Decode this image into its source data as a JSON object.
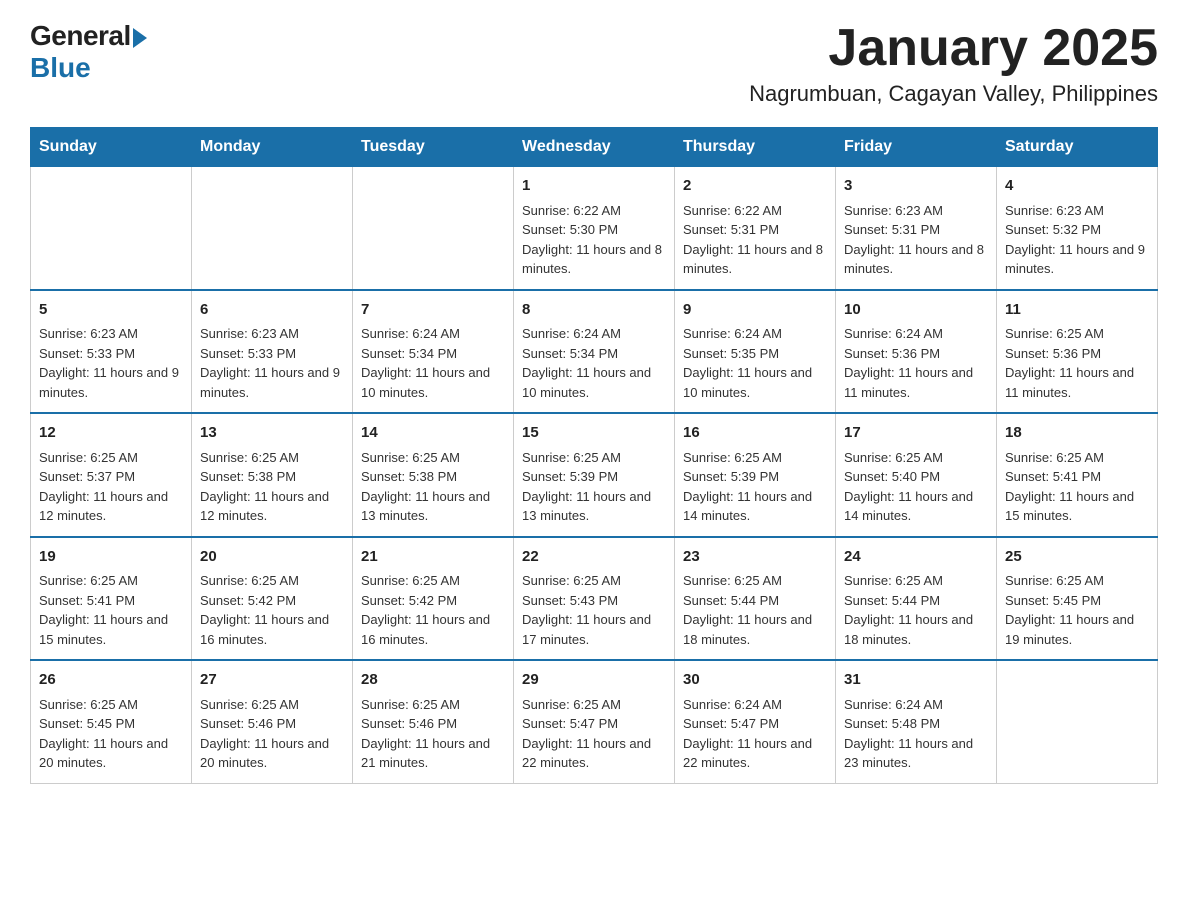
{
  "logo": {
    "general": "General",
    "blue": "Blue"
  },
  "title": {
    "month_year": "January 2025",
    "location": "Nagrumbuan, Cagayan Valley, Philippines"
  },
  "headers": [
    "Sunday",
    "Monday",
    "Tuesday",
    "Wednesday",
    "Thursday",
    "Friday",
    "Saturday"
  ],
  "weeks": [
    [
      {
        "day": "",
        "info": ""
      },
      {
        "day": "",
        "info": ""
      },
      {
        "day": "",
        "info": ""
      },
      {
        "day": "1",
        "info": "Sunrise: 6:22 AM\nSunset: 5:30 PM\nDaylight: 11 hours and 8 minutes."
      },
      {
        "day": "2",
        "info": "Sunrise: 6:22 AM\nSunset: 5:31 PM\nDaylight: 11 hours and 8 minutes."
      },
      {
        "day": "3",
        "info": "Sunrise: 6:23 AM\nSunset: 5:31 PM\nDaylight: 11 hours and 8 minutes."
      },
      {
        "day": "4",
        "info": "Sunrise: 6:23 AM\nSunset: 5:32 PM\nDaylight: 11 hours and 9 minutes."
      }
    ],
    [
      {
        "day": "5",
        "info": "Sunrise: 6:23 AM\nSunset: 5:33 PM\nDaylight: 11 hours and 9 minutes."
      },
      {
        "day": "6",
        "info": "Sunrise: 6:23 AM\nSunset: 5:33 PM\nDaylight: 11 hours and 9 minutes."
      },
      {
        "day": "7",
        "info": "Sunrise: 6:24 AM\nSunset: 5:34 PM\nDaylight: 11 hours and 10 minutes."
      },
      {
        "day": "8",
        "info": "Sunrise: 6:24 AM\nSunset: 5:34 PM\nDaylight: 11 hours and 10 minutes."
      },
      {
        "day": "9",
        "info": "Sunrise: 6:24 AM\nSunset: 5:35 PM\nDaylight: 11 hours and 10 minutes."
      },
      {
        "day": "10",
        "info": "Sunrise: 6:24 AM\nSunset: 5:36 PM\nDaylight: 11 hours and 11 minutes."
      },
      {
        "day": "11",
        "info": "Sunrise: 6:25 AM\nSunset: 5:36 PM\nDaylight: 11 hours and 11 minutes."
      }
    ],
    [
      {
        "day": "12",
        "info": "Sunrise: 6:25 AM\nSunset: 5:37 PM\nDaylight: 11 hours and 12 minutes."
      },
      {
        "day": "13",
        "info": "Sunrise: 6:25 AM\nSunset: 5:38 PM\nDaylight: 11 hours and 12 minutes."
      },
      {
        "day": "14",
        "info": "Sunrise: 6:25 AM\nSunset: 5:38 PM\nDaylight: 11 hours and 13 minutes."
      },
      {
        "day": "15",
        "info": "Sunrise: 6:25 AM\nSunset: 5:39 PM\nDaylight: 11 hours and 13 minutes."
      },
      {
        "day": "16",
        "info": "Sunrise: 6:25 AM\nSunset: 5:39 PM\nDaylight: 11 hours and 14 minutes."
      },
      {
        "day": "17",
        "info": "Sunrise: 6:25 AM\nSunset: 5:40 PM\nDaylight: 11 hours and 14 minutes."
      },
      {
        "day": "18",
        "info": "Sunrise: 6:25 AM\nSunset: 5:41 PM\nDaylight: 11 hours and 15 minutes."
      }
    ],
    [
      {
        "day": "19",
        "info": "Sunrise: 6:25 AM\nSunset: 5:41 PM\nDaylight: 11 hours and 15 minutes."
      },
      {
        "day": "20",
        "info": "Sunrise: 6:25 AM\nSunset: 5:42 PM\nDaylight: 11 hours and 16 minutes."
      },
      {
        "day": "21",
        "info": "Sunrise: 6:25 AM\nSunset: 5:42 PM\nDaylight: 11 hours and 16 minutes."
      },
      {
        "day": "22",
        "info": "Sunrise: 6:25 AM\nSunset: 5:43 PM\nDaylight: 11 hours and 17 minutes."
      },
      {
        "day": "23",
        "info": "Sunrise: 6:25 AM\nSunset: 5:44 PM\nDaylight: 11 hours and 18 minutes."
      },
      {
        "day": "24",
        "info": "Sunrise: 6:25 AM\nSunset: 5:44 PM\nDaylight: 11 hours and 18 minutes."
      },
      {
        "day": "25",
        "info": "Sunrise: 6:25 AM\nSunset: 5:45 PM\nDaylight: 11 hours and 19 minutes."
      }
    ],
    [
      {
        "day": "26",
        "info": "Sunrise: 6:25 AM\nSunset: 5:45 PM\nDaylight: 11 hours and 20 minutes."
      },
      {
        "day": "27",
        "info": "Sunrise: 6:25 AM\nSunset: 5:46 PM\nDaylight: 11 hours and 20 minutes."
      },
      {
        "day": "28",
        "info": "Sunrise: 6:25 AM\nSunset: 5:46 PM\nDaylight: 11 hours and 21 minutes."
      },
      {
        "day": "29",
        "info": "Sunrise: 6:25 AM\nSunset: 5:47 PM\nDaylight: 11 hours and 22 minutes."
      },
      {
        "day": "30",
        "info": "Sunrise: 6:24 AM\nSunset: 5:47 PM\nDaylight: 11 hours and 22 minutes."
      },
      {
        "day": "31",
        "info": "Sunrise: 6:24 AM\nSunset: 5:48 PM\nDaylight: 11 hours and 23 minutes."
      },
      {
        "day": "",
        "info": ""
      }
    ]
  ]
}
